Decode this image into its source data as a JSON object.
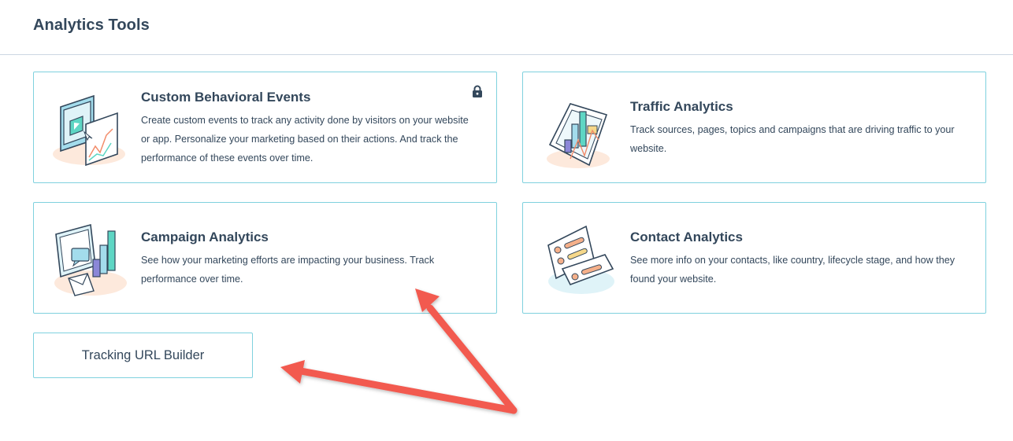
{
  "page": {
    "title": "Analytics Tools"
  },
  "cards": [
    {
      "title": "Custom Behavioral Events",
      "description": "Create custom events to track any activity done by visitors on your website or app. Personalize your marketing based on their actions. And track the performance of these events over time.",
      "icon": "video-chart-illustration",
      "locked": true,
      "badge_icon": "lock-icon"
    },
    {
      "title": "Traffic Analytics",
      "description": "Track sources, pages, topics and campaigns that are driving traffic to your website.",
      "icon": "traffic-chart-illustration",
      "locked": false
    },
    {
      "title": "Campaign Analytics",
      "description": "See how your marketing efforts are impacting your business. Track performance over time.",
      "icon": "campaign-chart-illustration",
      "locked": false
    },
    {
      "title": "Contact Analytics",
      "description": "See more info on your contacts, like country, lifecycle stage, and how they found your website.",
      "icon": "contact-list-illustration",
      "locked": false
    }
  ],
  "url_builder": {
    "label": "Tracking URL Builder"
  },
  "colors": {
    "card_border": "#7fd1de",
    "text": "#33475b",
    "divider": "#cbd6e2",
    "annotation_arrow": "#f25a50",
    "illus_teal": "#5ed6c4",
    "illus_purple": "#8b87d8",
    "illus_blue": "#a3dcec",
    "illus_orange": "#f5b08a",
    "illus_yellow": "#f5d78a",
    "illus_outline": "#33475b"
  }
}
